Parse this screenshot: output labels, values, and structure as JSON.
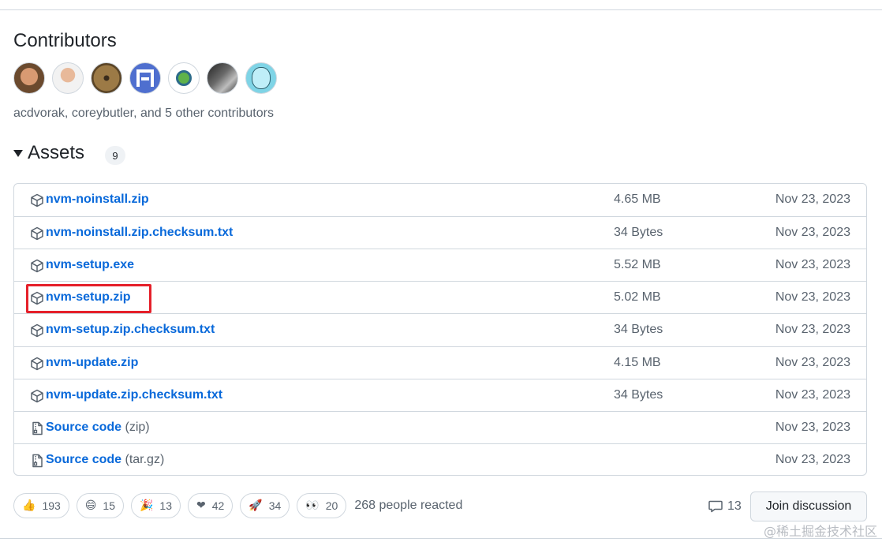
{
  "contributors": {
    "title": "Contributors",
    "text": "acdvorak, coreybutler, and 5 other contributors",
    "avatars": [
      "acdvorak",
      "coreybutler",
      "contributor-3",
      "contributor-4",
      "contributor-5",
      "contributor-6",
      "contributor-7"
    ]
  },
  "assets": {
    "title": "Assets",
    "count": "9",
    "items": [
      {
        "name": "nvm-noinstall.zip",
        "ext": "",
        "size": "4.65 MB",
        "date": "Nov 23, 2023",
        "icon": "package-icon"
      },
      {
        "name": "nvm-noinstall.zip.checksum.txt",
        "ext": "",
        "size": "34 Bytes",
        "date": "Nov 23, 2023",
        "icon": "package-icon"
      },
      {
        "name": "nvm-setup.exe",
        "ext": "",
        "size": "5.52 MB",
        "date": "Nov 23, 2023",
        "icon": "package-icon"
      },
      {
        "name": "nvm-setup.zip",
        "ext": "",
        "size": "5.02 MB",
        "date": "Nov 23, 2023",
        "icon": "package-icon"
      },
      {
        "name": "nvm-setup.zip.checksum.txt",
        "ext": "",
        "size": "34 Bytes",
        "date": "Nov 23, 2023",
        "icon": "package-icon"
      },
      {
        "name": "nvm-update.zip",
        "ext": "",
        "size": "4.15 MB",
        "date": "Nov 23, 2023",
        "icon": "package-icon"
      },
      {
        "name": "nvm-update.zip.checksum.txt",
        "ext": "",
        "size": "34 Bytes",
        "date": "Nov 23, 2023",
        "icon": "package-icon"
      },
      {
        "name": "Source code",
        "ext": "(zip)",
        "size": "",
        "date": "Nov 23, 2023",
        "icon": "file-zip-icon"
      },
      {
        "name": "Source code",
        "ext": "(tar.gz)",
        "size": "",
        "date": "Nov 23, 2023",
        "icon": "file-zip-icon"
      }
    ]
  },
  "reactions": {
    "items": [
      {
        "emoji": "👍",
        "count": "193"
      },
      {
        "emoji": "😄",
        "count": "15"
      },
      {
        "emoji": "🎉",
        "count": "13"
      },
      {
        "emoji": "❤",
        "count": "42"
      },
      {
        "emoji": "🚀",
        "count": "34"
      },
      {
        "emoji": "👀",
        "count": "20"
      }
    ],
    "summary": "268 people reacted"
  },
  "discussion": {
    "comment_count": "13",
    "join_label": "Join discussion"
  },
  "colors": {
    "link": "#0969da",
    "muted": "#59636e",
    "border": "#d0d7de",
    "highlight": "#e5202a"
  },
  "watermark": "@稀土掘金技术社区"
}
